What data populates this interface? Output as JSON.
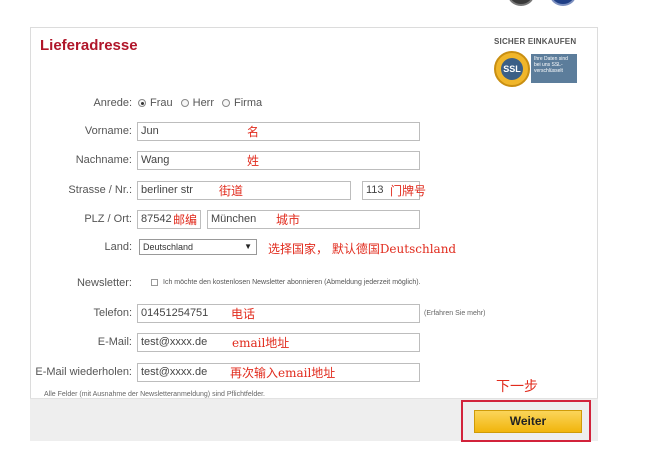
{
  "form": {
    "title": "Lieferadresse",
    "ssl": {
      "heading": "SICHER EINKAUFEN",
      "seal_text": "SSL",
      "info_text": "Ihre Daten sind bei uns SSL-verschlüsselt"
    },
    "anrede": {
      "label": "Anrede:",
      "options": [
        {
          "label": "Frau",
          "checked": true
        },
        {
          "label": "Herr",
          "checked": false
        },
        {
          "label": "Firma",
          "checked": false
        }
      ]
    },
    "vorname": {
      "label": "Vorname:",
      "value": "Jun"
    },
    "nachname": {
      "label": "Nachname:",
      "value": "Wang"
    },
    "strasse": {
      "label": "Strasse / Nr.:",
      "street": "berliner str",
      "number": "113"
    },
    "plz_ort": {
      "label": "PLZ / Ort:",
      "plz": "87542",
      "ort": "München"
    },
    "land": {
      "label": "Land:",
      "selected": "Deutschland"
    },
    "newsletter": {
      "label": "Newsletter:",
      "checked": false,
      "text": "Ich möchte den kostenlosen Newsletter abonnieren (Abmeldung jederzeit möglich)."
    },
    "telefon": {
      "label": "Telefon:",
      "value": "01451254751",
      "hint": "(Erfahren Sie mehr)"
    },
    "email": {
      "label": "E-Mail:",
      "value": "test@xxxx.de"
    },
    "email_repeat": {
      "label": "E-Mail wiederholen:",
      "value": "test@xxxx.de"
    },
    "required_note": "Alle Felder (mit Ausnahme der Newsletteranmeldung) sind Pflichtfelder.",
    "submit_label": "Weiter"
  },
  "annotations": {
    "vorname": "名",
    "nachname": "姓",
    "strasse": "街道",
    "hausnummer": "门牌号",
    "plz": "邮编",
    "ort": "城市",
    "land": "选择国家，  默认德国Deutschland",
    "telefon": "电话",
    "email": "email地址",
    "email_repeat": "再次输入email地址",
    "next_step": "下一步"
  },
  "colors": {
    "title": "#b0162a",
    "annotation": "#e12b1d",
    "button": "#f1b50c",
    "highlight_frame": "#d2233b"
  }
}
